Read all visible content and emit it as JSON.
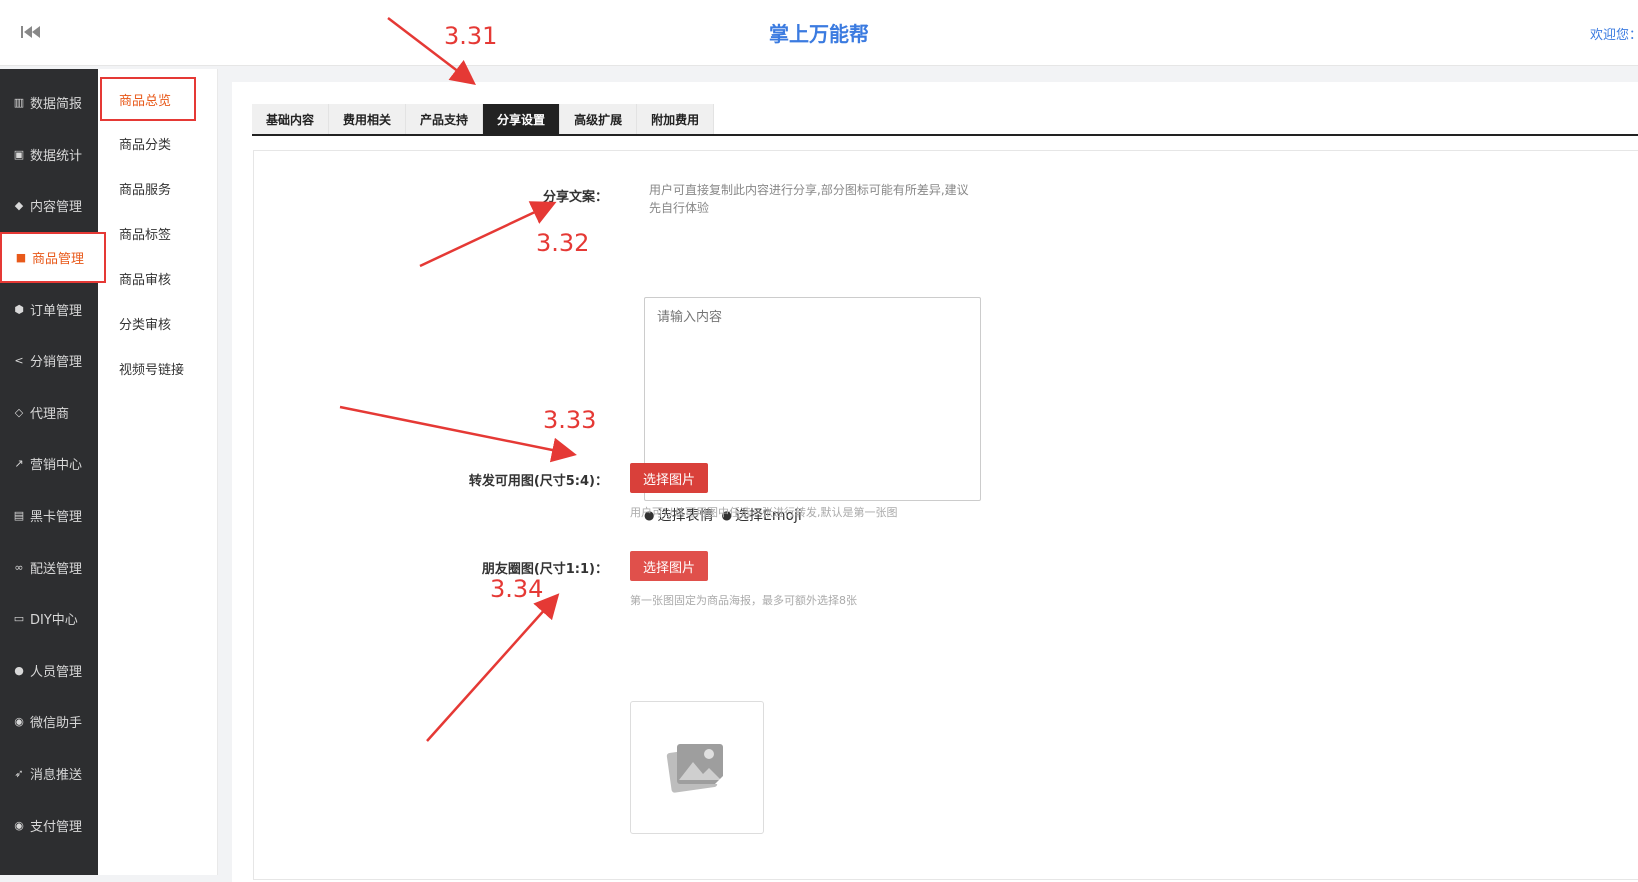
{
  "header": {
    "title": "掌上万能帮",
    "welcome": "欢迎您："
  },
  "sidebar": {
    "items": [
      {
        "label": "数据简报",
        "icon": "bar-chart-icon",
        "glyph": "▥"
      },
      {
        "label": "数据统计",
        "icon": "money-icon",
        "glyph": "▣"
      },
      {
        "label": "内容管理",
        "icon": "tag-icon",
        "glyph": "◆"
      },
      {
        "label": "商品管理",
        "icon": "shopping-bag-icon",
        "glyph": "■",
        "active": true
      },
      {
        "label": "订单管理",
        "icon": "cube-icon",
        "glyph": "⬢"
      },
      {
        "label": "分销管理",
        "icon": "share-icon",
        "glyph": "<"
      },
      {
        "label": "代理商",
        "icon": "diamond-icon",
        "glyph": "◇"
      },
      {
        "label": "营销中心",
        "icon": "line-chart-icon",
        "glyph": "↗"
      },
      {
        "label": "黑卡管理",
        "icon": "id-card-icon",
        "glyph": "▤"
      },
      {
        "label": "配送管理",
        "icon": "motorcycle-icon",
        "glyph": "∞"
      },
      {
        "label": "DIY中心",
        "icon": "monitor-icon",
        "glyph": "▭"
      },
      {
        "label": "人员管理",
        "icon": "users-icon",
        "glyph": "●"
      },
      {
        "label": "微信助手",
        "icon": "wechat-icon",
        "glyph": "◉"
      },
      {
        "label": "消息推送",
        "icon": "send-icon",
        "glyph": "➶"
      },
      {
        "label": "支付管理",
        "icon": "wechat-pay-icon",
        "glyph": "◉"
      }
    ]
  },
  "subnav": {
    "items": [
      "商品总览",
      "商品分类",
      "商品服务",
      "商品标签",
      "商品审核",
      "分类审核",
      "视频号链接"
    ]
  },
  "tabs": [
    "基础内容",
    "费用相关",
    "产品支持",
    "分享设置",
    "高级扩展",
    "附加费用"
  ],
  "active_tab": "分享设置",
  "form": {
    "share_text": {
      "label": "分享文案：",
      "help": "用户可直接复制此内容进行分享,部分图标可能有所差异,建议先自行体验",
      "placeholder": "请输入内容",
      "emoji1": "选择表情",
      "emoji2": "选择Emoji"
    },
    "forward_image": {
      "label": "转发可用图(尺寸5:4)：",
      "button": "选择图片",
      "help": "用户可以从可用图中任选一张进行转发,默认是第一张图"
    },
    "moments_image": {
      "label": "朋友圈图(尺寸1:1)：",
      "button": "选择图片",
      "help": "第一张图固定为商品海报，最多可额外选择8张"
    }
  },
  "annotations": [
    "3.31",
    "3.32",
    "3.33",
    "3.34"
  ],
  "colors": {
    "accent": "#3b7be0",
    "sidebar_bg": "#2d2e30",
    "active_orange": "#e8591a",
    "highlight_red": "#e53935",
    "button_red": "#d9403a",
    "button_red_light": "#e0504b"
  }
}
